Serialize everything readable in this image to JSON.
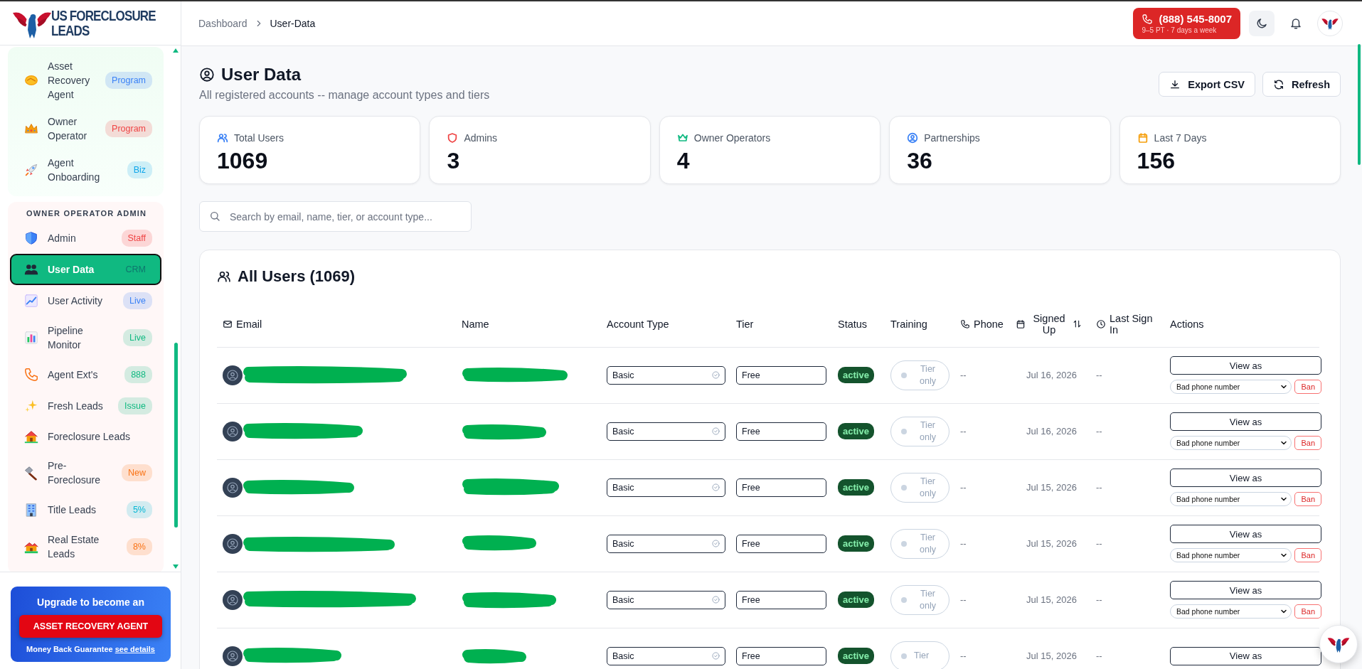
{
  "logo": {
    "line1": "US FORECLOSURE",
    "line2": "LEADS"
  },
  "sidebar": {
    "groups": [
      {
        "items": [
          {
            "label": "Asset Recovery Agent",
            "badge": "Program",
            "color": "#3b82f6",
            "selected": false
          },
          {
            "label": "Owner Operator",
            "badge": "Program",
            "color": "#ef4444",
            "selected": false
          },
          {
            "label": "Agent Onboarding",
            "badge": "Biz",
            "color": "#0ea5e9",
            "selected": false
          }
        ]
      },
      {
        "title": "OWNER OPERATOR ADMIN",
        "items": [
          {
            "label": "Admin",
            "badge": "Staff",
            "color": "#ef4444",
            "selected": false
          },
          {
            "label": "User Data",
            "badge": "CRM",
            "color": "#0f766e",
            "selected": true
          },
          {
            "label": "User Activity",
            "badge": "Live",
            "color": "#3b82f6",
            "selected": false
          },
          {
            "label": "Pipeline Monitor",
            "badge": "Live",
            "color": "#10b981",
            "selected": false
          },
          {
            "label": "Agent Ext's",
            "badge": "888",
            "color": "#10b981",
            "selected": false
          },
          {
            "label": "Fresh Leads",
            "badge": "Issue",
            "color": "#10b981",
            "selected": false
          },
          {
            "label": "Foreclosure Leads",
            "selected": false
          },
          {
            "label": "Pre-Foreclosure",
            "badge": "New",
            "color": "#f97316",
            "selected": false
          },
          {
            "label": "Title Leads",
            "badge": "5%",
            "color": "#06b6d4",
            "selected": false
          },
          {
            "label": "Real Estate Leads",
            "badge": "8%",
            "color": "#f97316",
            "selected": false
          }
        ]
      }
    ]
  },
  "upgrade": {
    "heading": "Upgrade to become an",
    "button": "ASSET RECOVERY AGENT",
    "note": "Money Back Guarantee",
    "link": "see details"
  },
  "header": {
    "breadcrumb": [
      "Dashboard",
      "User-Data"
    ],
    "phone": {
      "number": "(888) 545-8007",
      "hours": "9–5 PT · 7 days a week"
    }
  },
  "page": {
    "title": "User Data",
    "subtitle": "All registered accounts -- manage account types and tiers",
    "actions": [
      "Export CSV",
      "Refresh"
    ]
  },
  "stats": [
    {
      "label": "Total Users",
      "value": "1069",
      "color": "#3b82f6"
    },
    {
      "label": "Admins",
      "value": "3",
      "color": "#ef4444"
    },
    {
      "label": "Owner Operators",
      "value": "4",
      "color": "#10b981"
    },
    {
      "label": "Partnerships",
      "value": "36",
      "color": "#3b82f6"
    },
    {
      "label": "Last 7 Days",
      "value": "156",
      "color": "#f59e0b"
    }
  ],
  "search": {
    "placeholder": "Search by email, name, tier, or account type..."
  },
  "table": {
    "title": "All Users (1069)",
    "columns": [
      "Email",
      "Name",
      "Account Type",
      "Tier",
      "Status",
      "Training",
      "Phone",
      "Signed Up",
      "Last Sign In",
      "Actions"
    ],
    "rows": [
      {
        "email_redacted": true,
        "name_redacted": true,
        "account_type": "Basic",
        "tier": "Free",
        "status": "active",
        "training": "Tier only",
        "training_on": false,
        "phone": "--",
        "signed_up": "Jul 16, 2026",
        "last_sign_in": "--",
        "view": "View as",
        "reason": "Bad phone number",
        "ban": "Ban"
      },
      {
        "email_redacted": true,
        "name_redacted": true,
        "account_type": "Basic",
        "tier": "Free",
        "status": "active",
        "training": "Tier only",
        "training_on": false,
        "phone": "--",
        "signed_up": "Jul 16, 2026",
        "last_sign_in": "--",
        "view": "View as",
        "reason": "Bad phone number",
        "ban": "Ban"
      },
      {
        "email_redacted": true,
        "name_redacted": true,
        "account_type": "Basic",
        "tier": "Free",
        "status": "active",
        "training": "Tier only",
        "training_on": false,
        "phone": "--",
        "signed_up": "Jul 15, 2026",
        "last_sign_in": "--",
        "view": "View as",
        "reason": "Bad phone number",
        "ban": "Ban"
      },
      {
        "email_redacted": true,
        "name_redacted": true,
        "account_type": "Basic",
        "tier": "Free",
        "status": "active",
        "training": "Tier only",
        "training_on": false,
        "phone": "--",
        "signed_up": "Jul 15, 2026",
        "last_sign_in": "--",
        "view": "View as",
        "reason": "Bad phone number",
        "ban": "Ban"
      },
      {
        "email_redacted": true,
        "name_redacted": true,
        "account_type": "Basic",
        "tier": "Free",
        "status": "active",
        "training": "Tier only",
        "training_on": false,
        "phone": "--",
        "signed_up": "Jul 15, 2026",
        "last_sign_in": "--",
        "view": "View as",
        "reason": "Bad phone number",
        "ban": "Ban"
      },
      {
        "email_redacted": true,
        "name_redacted": true,
        "account_type": "Basic",
        "tier": "Free",
        "status": "active",
        "training": "Tier",
        "training_on": false,
        "phone": "--",
        "signed_up": "Jul 15, 2026",
        "last_sign_in": "--",
        "view": "View as"
      }
    ]
  }
}
